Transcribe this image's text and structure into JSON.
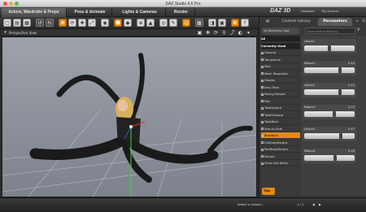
{
  "window": {
    "title": "DAZ Studio 4.6 Pro"
  },
  "top_tabs": [
    "Actors, Wardrobe & Props",
    "Pose & Animate",
    "Lights & Cameras",
    "Render"
  ],
  "brand": "DAZ 3D",
  "top_links": [
    "Feedback",
    "My Account"
  ],
  "viewport": {
    "label": "Perspective View"
  },
  "panel": {
    "tabs": [
      "Content Library",
      "Parameters"
    ],
    "selector": "V4 Dominika Coat",
    "filter_placeholder": "Enter text to filter by...",
    "left_items": [
      {
        "label": "All",
        "kind": "head"
      },
      {
        "label": "Currently Used",
        "kind": "head"
      },
      {
        "label": "General",
        "kind": "item"
      },
      {
        "label": "Transforms",
        "kind": "item"
      },
      {
        "label": "Misc",
        "kind": "item"
      },
      {
        "label": "Mesh Resolution",
        "kind": "item"
      },
      {
        "label": "Display",
        "kind": "item"
      },
      {
        "label": "Easy-Pose",
        "kind": "item"
      },
      {
        "label": "Posing Morphs",
        "kind": "item"
      },
      {
        "label": "Pain",
        "kind": "item"
      },
      {
        "label": "TwistInward",
        "kind": "item"
      },
      {
        "label": "TwistForward",
        "kind": "item"
      },
      {
        "label": "TwistBack",
        "kind": "item"
      },
      {
        "label": "Side-to-Side",
        "kind": "item"
      },
      {
        "label": "BlowBack",
        "kind": "sel"
      },
      {
        "label": "FullBodyMorphs",
        "kind": "item"
      },
      {
        "label": "PartBodyMorphs",
        "kind": "item"
      },
      {
        "label": "Morphs",
        "kind": "item"
      },
      {
        "label": "Show Sub Items",
        "kind": "item"
      }
    ],
    "params": [
      {
        "name": "LBack2",
        "value": "",
        "fraction": 0.5
      },
      {
        "name": "RBack2",
        "value": "0.43",
        "fraction": 0.72
      },
      {
        "name": "LBack3",
        "value": "0.43",
        "fraction": 0.72
      },
      {
        "name": "RBack3",
        "value": "0.23",
        "fraction": 0.6
      },
      {
        "name": "LBack4",
        "value": "0.47",
        "fraction": 0.74
      },
      {
        "name": "RBack4",
        "value": "0.28",
        "fraction": 0.62
      }
    ],
    "tips_label": "Tips"
  },
  "bottom": {
    "lesson": "Select a Lesson...",
    "paging": "1 / 1"
  }
}
